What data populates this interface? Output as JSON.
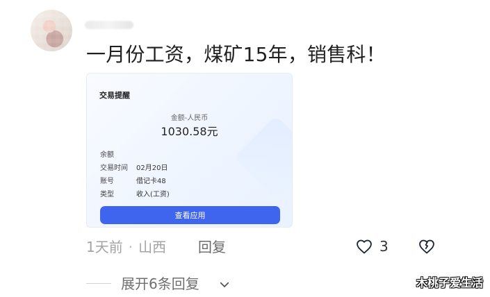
{
  "comment": {
    "text": "一月份工资，煤矿15年，销售科！",
    "meta": {
      "time": "1天前",
      "location": "山西",
      "reply_label": "回复"
    },
    "likes": {
      "count": "3",
      "icon": "heart-outline-icon"
    },
    "dislike_icon": "broken-heart-icon",
    "expand_replies": "展开6条回复"
  },
  "transaction_card": {
    "title": "交易提醒",
    "amount_label": "金额-人民币",
    "amount_value": "1030.58元",
    "rows": [
      {
        "label": "余额",
        "value": ""
      },
      {
        "label": "交易时间",
        "value": "02月20日"
      },
      {
        "label": "账号",
        "value": "借记卡48"
      },
      {
        "label": "类型",
        "value": "收入(工资)"
      }
    ],
    "button_label": "查看应用"
  },
  "watermark": "木桃子爱生活",
  "colors": {
    "primary_button": "#3f64ee",
    "meta_gray": "#a3a3a3",
    "reply_gray": "#6a6a6a"
  },
  "icons": {
    "avatar": "avatar",
    "heart": "heart-outline-icon",
    "broken_heart": "broken-heart-icon",
    "chevron": "chevron-down-icon"
  }
}
